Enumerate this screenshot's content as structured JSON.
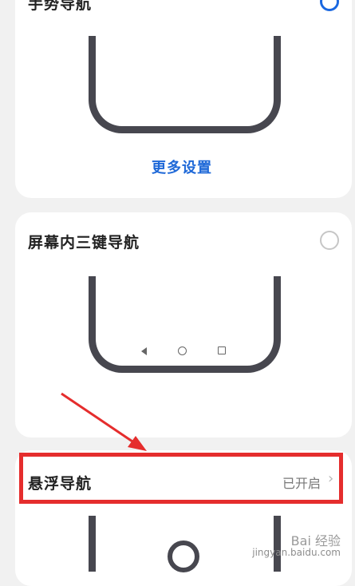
{
  "gesture_nav": {
    "title": "手势导航",
    "selected": true,
    "more_settings_label": "更多设置"
  },
  "three_key_nav": {
    "title": "屏幕内三键导航",
    "selected": false
  },
  "floating_nav": {
    "title": "悬浮导航",
    "status": "已开启"
  },
  "icons": {
    "radio_selected": "radio-checked-icon",
    "radio_unselected": "radio-unchecked-icon",
    "back": "back-triangle-icon",
    "home": "home-circle-icon",
    "recent": "recent-square-icon",
    "chevron": "chevron-right-icon"
  },
  "watermark": {
    "brand": "Bai 经验",
    "url": "jingyan.baidu.com"
  },
  "colors": {
    "accent": "#1a67e0",
    "annotation": "#e52d2d"
  }
}
